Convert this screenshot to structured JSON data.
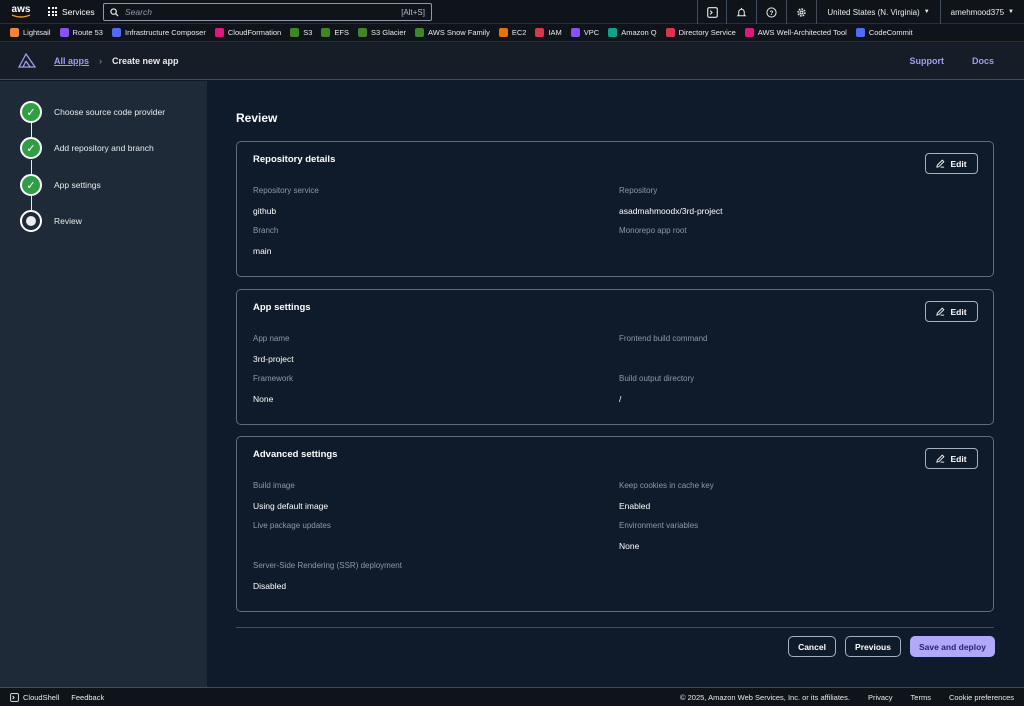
{
  "topnav": {
    "logo_text": "aws",
    "services_label": "Services",
    "search_placeholder": "Search",
    "search_shortcut": "[Alt+S]",
    "region": "United States (N. Virginia)",
    "user": "amehmood375"
  },
  "favorites": [
    {
      "label": "Lightsail",
      "color": "#f58534"
    },
    {
      "label": "Route 53",
      "color": "#8c4fff"
    },
    {
      "label": "Infrastructure Composer",
      "color": "#4d6bfe"
    },
    {
      "label": "CloudFormation",
      "color": "#e7157b"
    },
    {
      "label": "S3",
      "color": "#3f8624"
    },
    {
      "label": "EFS",
      "color": "#3f8624"
    },
    {
      "label": "S3 Glacier",
      "color": "#3f8624"
    },
    {
      "label": "AWS Snow Family",
      "color": "#3f8624"
    },
    {
      "label": "EC2",
      "color": "#ed7100"
    },
    {
      "label": "IAM",
      "color": "#dd344c"
    },
    {
      "label": "VPC",
      "color": "#8c4fff"
    },
    {
      "label": "Amazon Q",
      "color": "#01a88d"
    },
    {
      "label": "Directory Service",
      "color": "#dd344c"
    },
    {
      "label": "AWS Well-Architected Tool",
      "color": "#e7157b"
    },
    {
      "label": "CodeCommit",
      "color": "#4d6bfe"
    }
  ],
  "header": {
    "breadcrumb_link": "All apps",
    "breadcrumb_current": "Create new app",
    "support": "Support",
    "docs": "Docs"
  },
  "steps": [
    {
      "label": "Choose source code provider",
      "state": "done"
    },
    {
      "label": "Add repository and branch",
      "state": "done"
    },
    {
      "label": "App settings",
      "state": "done"
    },
    {
      "label": "Review",
      "state": "current"
    }
  ],
  "main": {
    "title": "Review",
    "edit_label": "Edit",
    "repo": {
      "heading": "Repository details",
      "service_label": "Repository service",
      "service_value": "github",
      "repository_label": "Repository",
      "repository_value": "asadmahmoodx/3rd-project",
      "branch_label": "Branch",
      "branch_value": "main",
      "monorepo_label": "Monorepo app root"
    },
    "app": {
      "heading": "App settings",
      "name_label": "App name",
      "name_value": "3rd-project",
      "frontend_label": "Frontend build command",
      "framework_label": "Framework",
      "framework_value": "None",
      "output_label": "Build output directory",
      "output_value": "/"
    },
    "advanced": {
      "heading": "Advanced settings",
      "image_label": "Build image",
      "image_value": "Using default image",
      "cookies_label": "Keep cookies in cache key",
      "cookies_value": "Enabled",
      "live_label": "Live package updates",
      "env_label": "Environment variables",
      "env_value": "None",
      "ssr_label": "Server-Side Rendering (SSR) deployment",
      "ssr_value": "Disabled"
    },
    "cancel": "Cancel",
    "previous": "Previous",
    "save": "Save and deploy"
  },
  "footer": {
    "cloudshell": "CloudShell",
    "feedback": "Feedback",
    "copyright": "© 2025, Amazon Web Services, Inc. or its affiliates.",
    "privacy": "Privacy",
    "terms": "Terms",
    "cookies": "Cookie preferences"
  },
  "colors": {
    "accent": "#a09cf0",
    "primary_button": "#b0a8fb",
    "step_done": "#2ea043"
  }
}
